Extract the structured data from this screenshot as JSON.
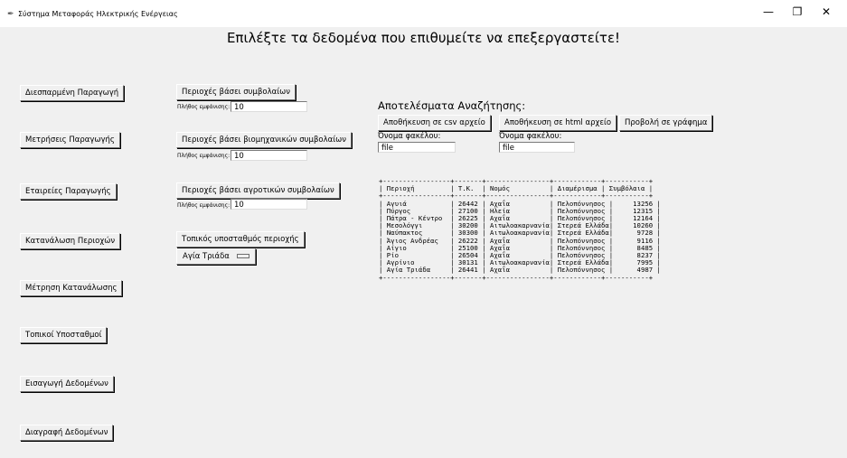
{
  "window": {
    "title": "Σύστημα Μεταφοράς Ηλεκτρικής Ενέργειας",
    "minimize": "—",
    "restore": "❐",
    "close": "✕"
  },
  "heading": "Επιλέξτε τα δεδομένα που επιθυμείτε να επεξεργαστείτε!",
  "left_buttons": [
    "Διεσπαρμένη Παραγωγή",
    "Μετρήσεις Παραγωγής",
    "Εταιρείες Παραγωγής",
    "Κατανάλωση Περιοχών",
    "Μέτρηση Κατανάλωσης",
    "Τοπικοί Υποσταθμοί",
    "Εισαγωγή Δεδομένων",
    "Διαγραφή Δεδομένων"
  ],
  "middle": {
    "btn1": "Περιοχές βάσει συμβολαίων",
    "btn2": "Περιοχές βάσει βιομηχανικών συμβολαίων",
    "btn3": "Περιοχές βάσει αγροτικών συμβολαίων",
    "btn4": "Τοπικός υποσταθμός περιοχής",
    "count_label": "Πλήθος εμφάνισης:",
    "count1": "10",
    "count2": "10",
    "count3": "10",
    "dropdown_value": "Αγία Τριάδα"
  },
  "results": {
    "title": "Αποτελέσματα Αναζήτησης:",
    "save_csv": "Αποθήκευση σε csv αρχείο",
    "save_html": "Αποθήκευση σε html αρχείο",
    "show_chart": "Προβολή σε γράφημα",
    "folder_label_1": "Όνομα φακέλου:",
    "folder_label_2": "Όνομα φακέλου:",
    "folder_value_1": "file",
    "folder_value_2": "file",
    "table_text": "+-----------------+-------+----------------+------------+-----------+\n| Περιοχή         | Τ.Κ.  | Νομός          | Διαμέρισμα | Συμβόλαια |\n+-----------------+-------+----------------+------------+-----------+\n| Αγυιά           | 26442 | Αχαΐα          | Πελοπόννησος |     13256 |\n| Πύργος          | 27100 | Ηλεία          | Πελοπόννησος |     12315 |\n| Πάτρα - Κέντρο  | 26225 | Αχαΐα          | Πελοπόννησος |     12164 |\n| Μεσολόγγι       | 30200 | Αιτωλοακαρνανία| Στερεά Ελλάδα|     10260 |\n| Ναύπακτος       | 30300 | Αιτωλοακαρνανία| Στερεά Ελλάδα|      9728 |\n| Άγιος Ανδρέας   | 26222 | Αχαΐα          | Πελοπόννησος |      9116 |\n| Αίγιο           | 25100 | Αχαΐα          | Πελοπόννησος |      8485 |\n| Ρίο             | 26504 | Αχαΐα          | Πελοπόννησος |      8237 |\n| Αγρίνιο         | 30131 | Αιτωλοακαρνανία| Στερεά Ελλάδα|      7995 |\n| Αγία Τριάδα     | 26441 | Αχαΐα          | Πελοπόννησος |      4987 |\n+-----------------+-------+----------------+------------+-----------+"
  }
}
